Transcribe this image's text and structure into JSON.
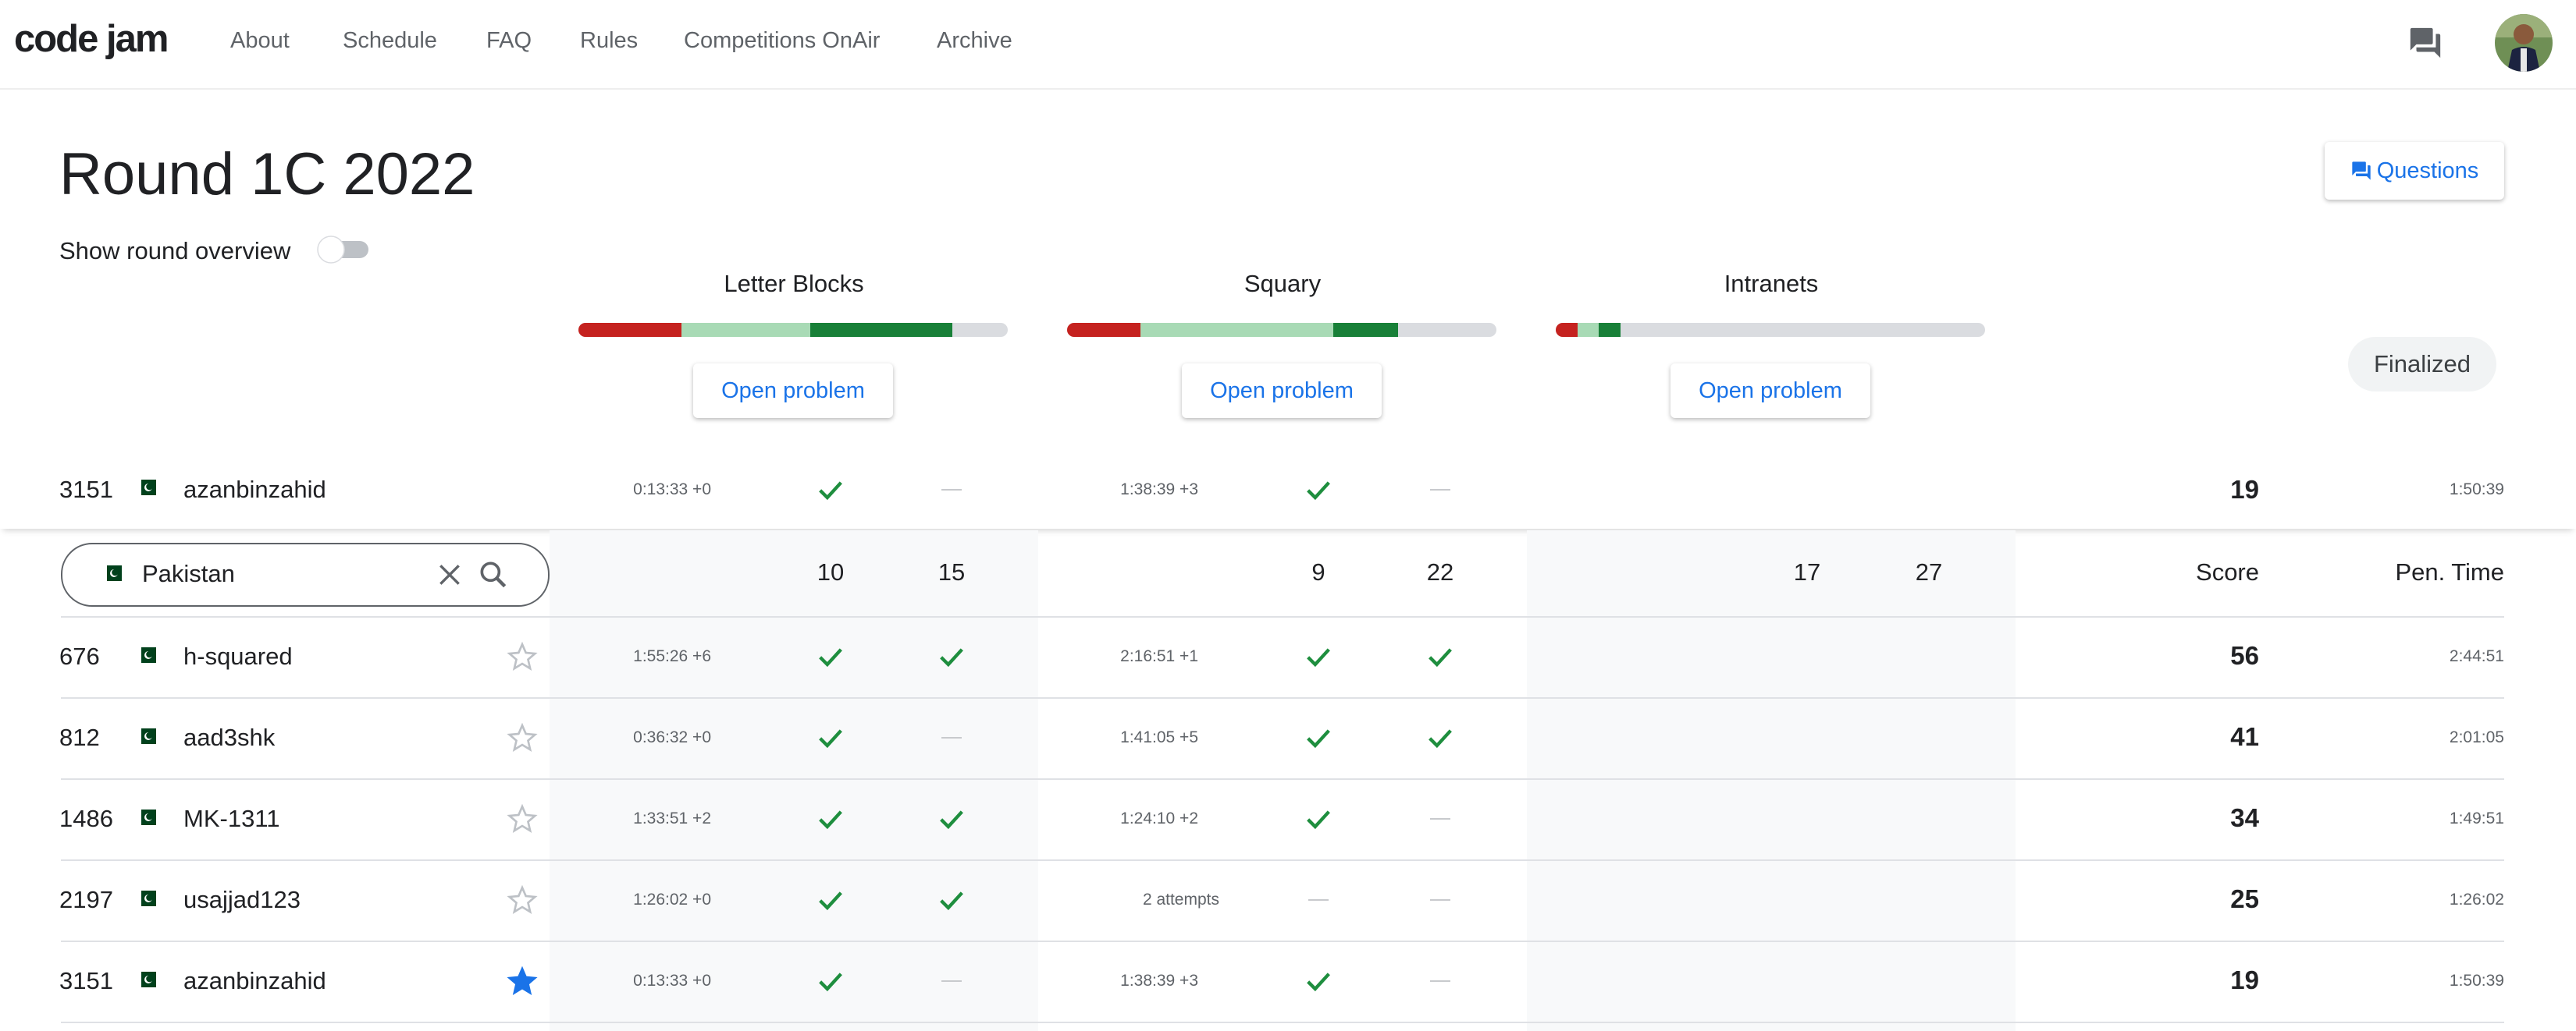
{
  "header": {
    "logo": "code jam",
    "nav": [
      "About",
      "Schedule",
      "FAQ",
      "Rules",
      "Competitions OnAir",
      "Archive"
    ]
  },
  "page": {
    "title": "Round 1C 2022",
    "questions_label": "Questions",
    "overview_label": "Show round overview",
    "finalized_label": "Finalized"
  },
  "problems": [
    {
      "name": "Letter Blocks",
      "open_label": "Open problem",
      "progress": [
        {
          "color": "#c5221f",
          "fraction": 0.24
        },
        {
          "color": "#a8dab5",
          "fraction": 0.3
        },
        {
          "color": "#188038",
          "fraction": 0.33
        }
      ]
    },
    {
      "name": "Squary",
      "open_label": "Open problem",
      "progress": [
        {
          "color": "#c5221f",
          "fraction": 0.17
        },
        {
          "color": "#a8dab5",
          "fraction": 0.45
        },
        {
          "color": "#188038",
          "fraction": 0.15
        }
      ]
    },
    {
      "name": "Intranets",
      "open_label": "Open problem",
      "progress": [
        {
          "color": "#c5221f",
          "fraction": 0.05
        },
        {
          "color": "#a8dab5",
          "fraction": 0.05
        },
        {
          "color": "#188038",
          "fraction": 0.05
        }
      ]
    }
  ],
  "colors": {
    "accent": "#1a73e8",
    "solved": "#1e8e3e"
  },
  "filter": {
    "country": "Pakistan"
  },
  "columns": {
    "p1": [
      "10",
      "15"
    ],
    "p2": [
      "9",
      "22"
    ],
    "p3": [
      "17",
      "27"
    ],
    "score": "Score",
    "pen_time": "Pen. Time"
  },
  "my_row": {
    "rank": "3151",
    "name": "azanbinzahid",
    "p1_time": "0:13:33 +0",
    "p1": [
      "check",
      "dash"
    ],
    "p2_time": "1:38:39 +3",
    "p2": [
      "check",
      "dash"
    ],
    "score": "19",
    "pen": "1:50:39"
  },
  "rows": [
    {
      "rank": "676",
      "name": "h-squared",
      "starred": false,
      "p1_time": "1:55:26 +6",
      "p1": [
        "check",
        "check"
      ],
      "p2_time": "2:16:51 +1",
      "p2": [
        "check",
        "check"
      ],
      "score": "56",
      "pen": "2:44:51"
    },
    {
      "rank": "812",
      "name": "aad3shk",
      "starred": false,
      "p1_time": "0:36:32 +0",
      "p1": [
        "check",
        "dash"
      ],
      "p2_time": "1:41:05 +5",
      "p2": [
        "check",
        "check"
      ],
      "score": "41",
      "pen": "2:01:05"
    },
    {
      "rank": "1486",
      "name": "MK-1311",
      "starred": false,
      "p1_time": "1:33:51 +2",
      "p1": [
        "check",
        "check"
      ],
      "p2_time": "1:24:10 +2",
      "p2": [
        "check",
        "dash"
      ],
      "score": "34",
      "pen": "1:49:51"
    },
    {
      "rank": "2197",
      "name": "usajjad123",
      "starred": false,
      "p1_time": "1:26:02 +0",
      "p1": [
        "check",
        "check"
      ],
      "p2_time": "2 attempts",
      "p2": [
        "dash",
        "dash"
      ],
      "score": "25",
      "pen": "1:26:02"
    },
    {
      "rank": "3151",
      "name": "azanbinzahid",
      "starred": true,
      "p1_time": "0:13:33 +0",
      "p1": [
        "check",
        "dash"
      ],
      "p2_time": "1:38:39 +3",
      "p2": [
        "check",
        "dash"
      ],
      "score": "19",
      "pen": "1:50:39"
    }
  ]
}
